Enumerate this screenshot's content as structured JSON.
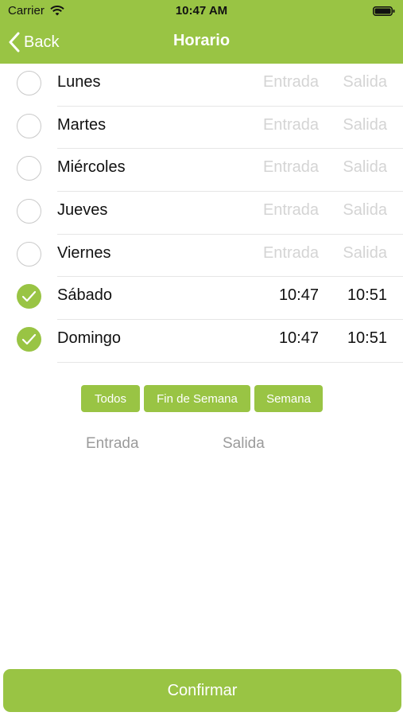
{
  "status_bar": {
    "carrier": "Carrier",
    "time": "10:47 AM"
  },
  "nav": {
    "back_label": "Back",
    "title": "Horario"
  },
  "days": [
    {
      "name": "Lunes",
      "checked": false,
      "entrada": "Entrada",
      "salida": "Salida",
      "set": false
    },
    {
      "name": "Martes",
      "checked": false,
      "entrada": "Entrada",
      "salida": "Salida",
      "set": false
    },
    {
      "name": "Miércoles",
      "checked": false,
      "entrada": "Entrada",
      "salida": "Salida",
      "set": false
    },
    {
      "name": "Jueves",
      "checked": false,
      "entrada": "Entrada",
      "salida": "Salida",
      "set": false
    },
    {
      "name": "Viernes",
      "checked": false,
      "entrada": "Entrada",
      "salida": "Salida",
      "set": false
    },
    {
      "name": "Sábado",
      "checked": true,
      "entrada": "10:47",
      "salida": "10:51",
      "set": true
    },
    {
      "name": "Domingo",
      "checked": true,
      "entrada": "10:47",
      "salida": "10:51",
      "set": true
    }
  ],
  "presets": {
    "todos": "Todos",
    "fin_de_semana": "Fin de Semana",
    "semana": "Semana"
  },
  "bulk": {
    "entrada_placeholder": "Entrada",
    "salida_placeholder": "Salida"
  },
  "confirm_label": "Confirmar",
  "colors": {
    "accent": "#99c444",
    "placeholder": "#d4d4d4",
    "text": "#111111"
  },
  "icons": {
    "wifi": "wifi-icon",
    "battery": "battery-icon",
    "back": "chevron-left-icon",
    "check": "checkmark-icon"
  }
}
